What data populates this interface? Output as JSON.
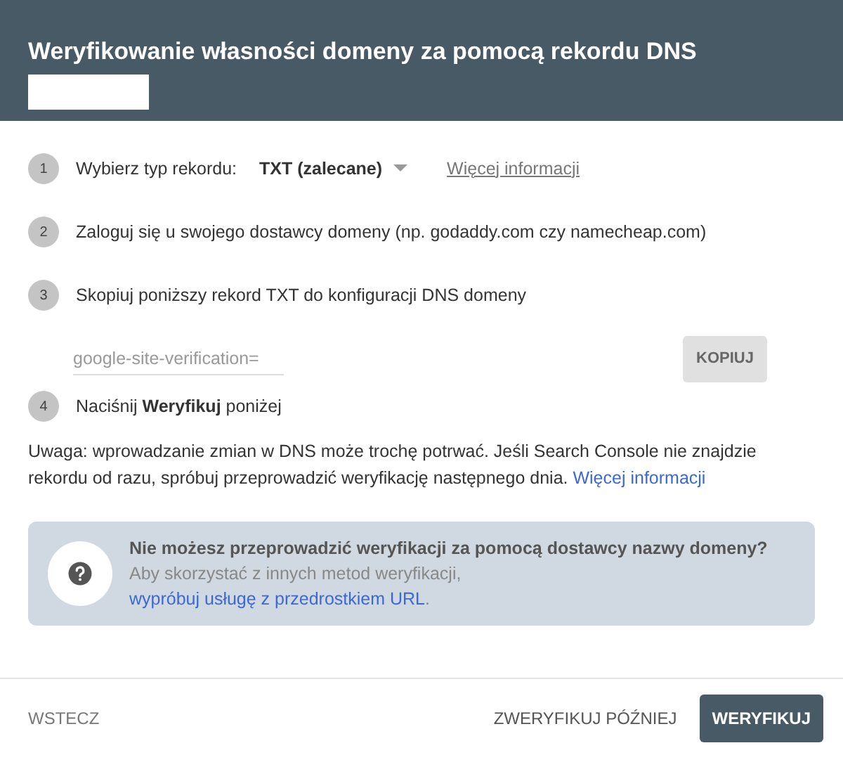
{
  "dialog": {
    "title": "Weryfikowanie własności domeny za pomocą rekordu DNS"
  },
  "steps": [
    {
      "number": "1",
      "kind": "select",
      "label": "Wybierz typ rekordu:",
      "value": "TXT (zalecane)",
      "link": "Więcej informacji"
    },
    {
      "number": "2",
      "kind": "text",
      "label": "Zaloguj się u swojego dostawcy domeny (np. godaddy.com czy namecheap.com)"
    },
    {
      "number": "3",
      "kind": "text",
      "label": "Skopiuj poniższy rekord TXT do konfiguracji DNS domeny"
    },
    {
      "number": "4",
      "kind": "text",
      "label": "Naciśnij **Weryfikuj** poniżej"
    }
  ],
  "record": {
    "value": "google-site-verification=",
    "button": "KOPIUJ"
  },
  "note": {
    "text": "Uwaga: wprowadzanie zmian w DNS może trochę potrwać. Jeśli Search Console nie znajdzie rekordu od razu, spróbuj przeprowadzić weryfikację następnego dnia.",
    "link": "Więcej informacji"
  },
  "help": {
    "title": "Nie możesz przeprowadzić weryfikacji za pomocą dostawcy nazwy domeny?",
    "text": "Aby skorzystać z innych metod weryfikacji,",
    "link": "wypróbuj usługę z przedrostkiem URL",
    "end": "."
  },
  "footer": {
    "back": "WSTECZ",
    "later": "ZWERYFIKUJ PÓŹNIEJ",
    "verify": "WERYFIKUJ"
  }
}
